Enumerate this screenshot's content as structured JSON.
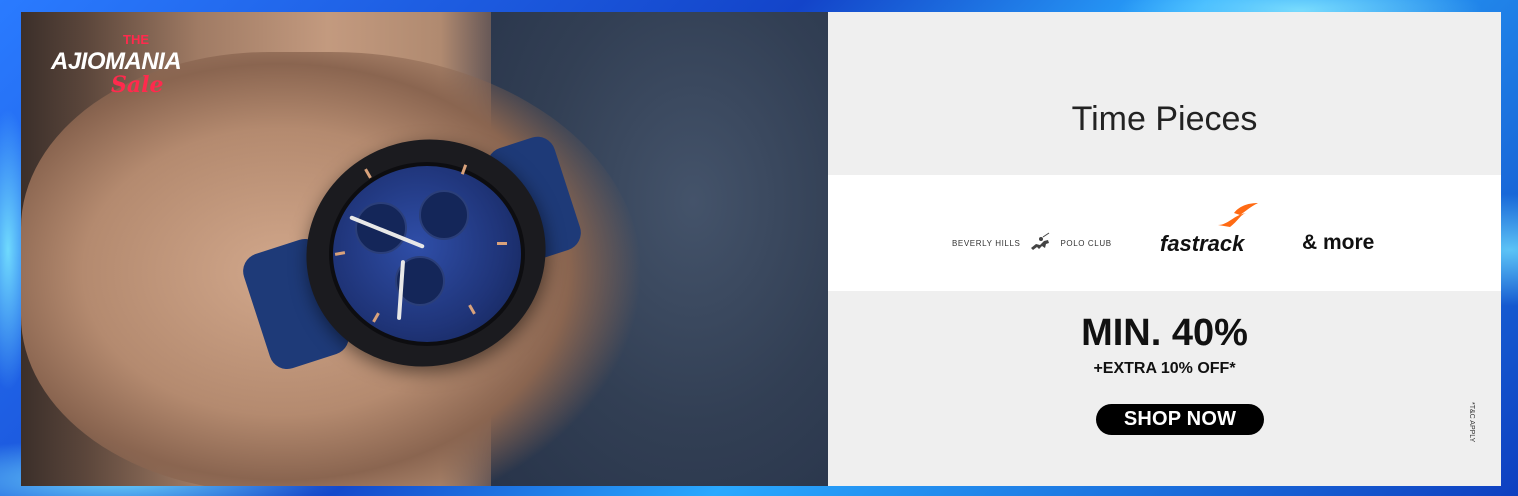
{
  "banner": {
    "logo": {
      "the": "THE",
      "main": "AJIOMANIA",
      "sale": "Sale"
    },
    "title": "Time Pieces",
    "brands": [
      {
        "name": "BEVERLY HILLS POLO CLUB",
        "part1": "BEVERLY HILLS",
        "part2": "POLO CLUB",
        "icon": "polo-horse-icon"
      },
      {
        "name": "fastrack",
        "icon": "fastrack-wing-icon",
        "accent": "#ff6a13"
      }
    ],
    "more": "& more",
    "offer": "MIN. 40%",
    "extra": "+EXTRA 10% OFF*",
    "cta": "SHOP NOW",
    "tnc": "*T&C APPLY"
  },
  "colors": {
    "frame": "#1a5fd6",
    "panel": "#efefef",
    "strip": "#ffffff",
    "brand_red": "#ff2a4d",
    "cta_bg": "#000000"
  }
}
